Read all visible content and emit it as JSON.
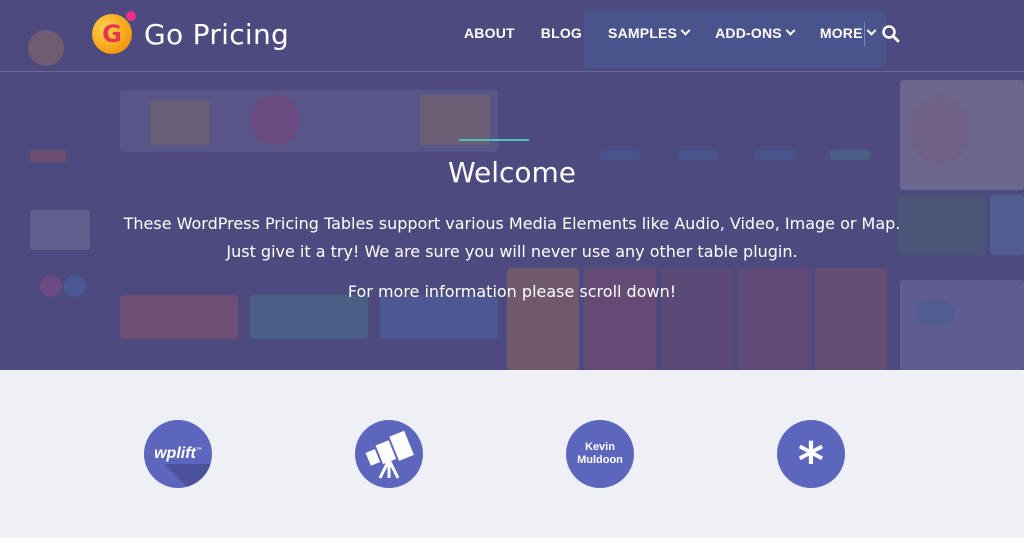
{
  "header": {
    "logo_text": "Go Pricing",
    "logo_letter": "G",
    "nav": [
      {
        "label": "ABOUT",
        "dropdown": false
      },
      {
        "label": "BLOG",
        "dropdown": false
      },
      {
        "label": "SAMPLES",
        "dropdown": true
      },
      {
        "label": "ADD-ONS",
        "dropdown": true
      },
      {
        "label": "MORE",
        "dropdown": true
      }
    ],
    "search_icon": "search-icon"
  },
  "hero": {
    "title": "Welcome",
    "text_line1": "These WordPress Pricing Tables support various Media Elements like Audio, Video, Image or Map.",
    "text_line2": "Just give it a try! We are sure you will never use any other table plugin.",
    "more": "For more information please scroll down!",
    "accent_color": "#4fc4b3",
    "overlay_color": "#4e4a80"
  },
  "partners": {
    "wplift": {
      "label": "wplift",
      "sup": "™"
    },
    "telescope": {
      "icon": "telescope-icon"
    },
    "kevin": {
      "line1": "Kevin",
      "line2": "Muldoon"
    },
    "asterisk": {
      "label": "*"
    },
    "circle_color": "#5c66bd"
  },
  "colors": {
    "page_bg": "#eff0f5"
  }
}
